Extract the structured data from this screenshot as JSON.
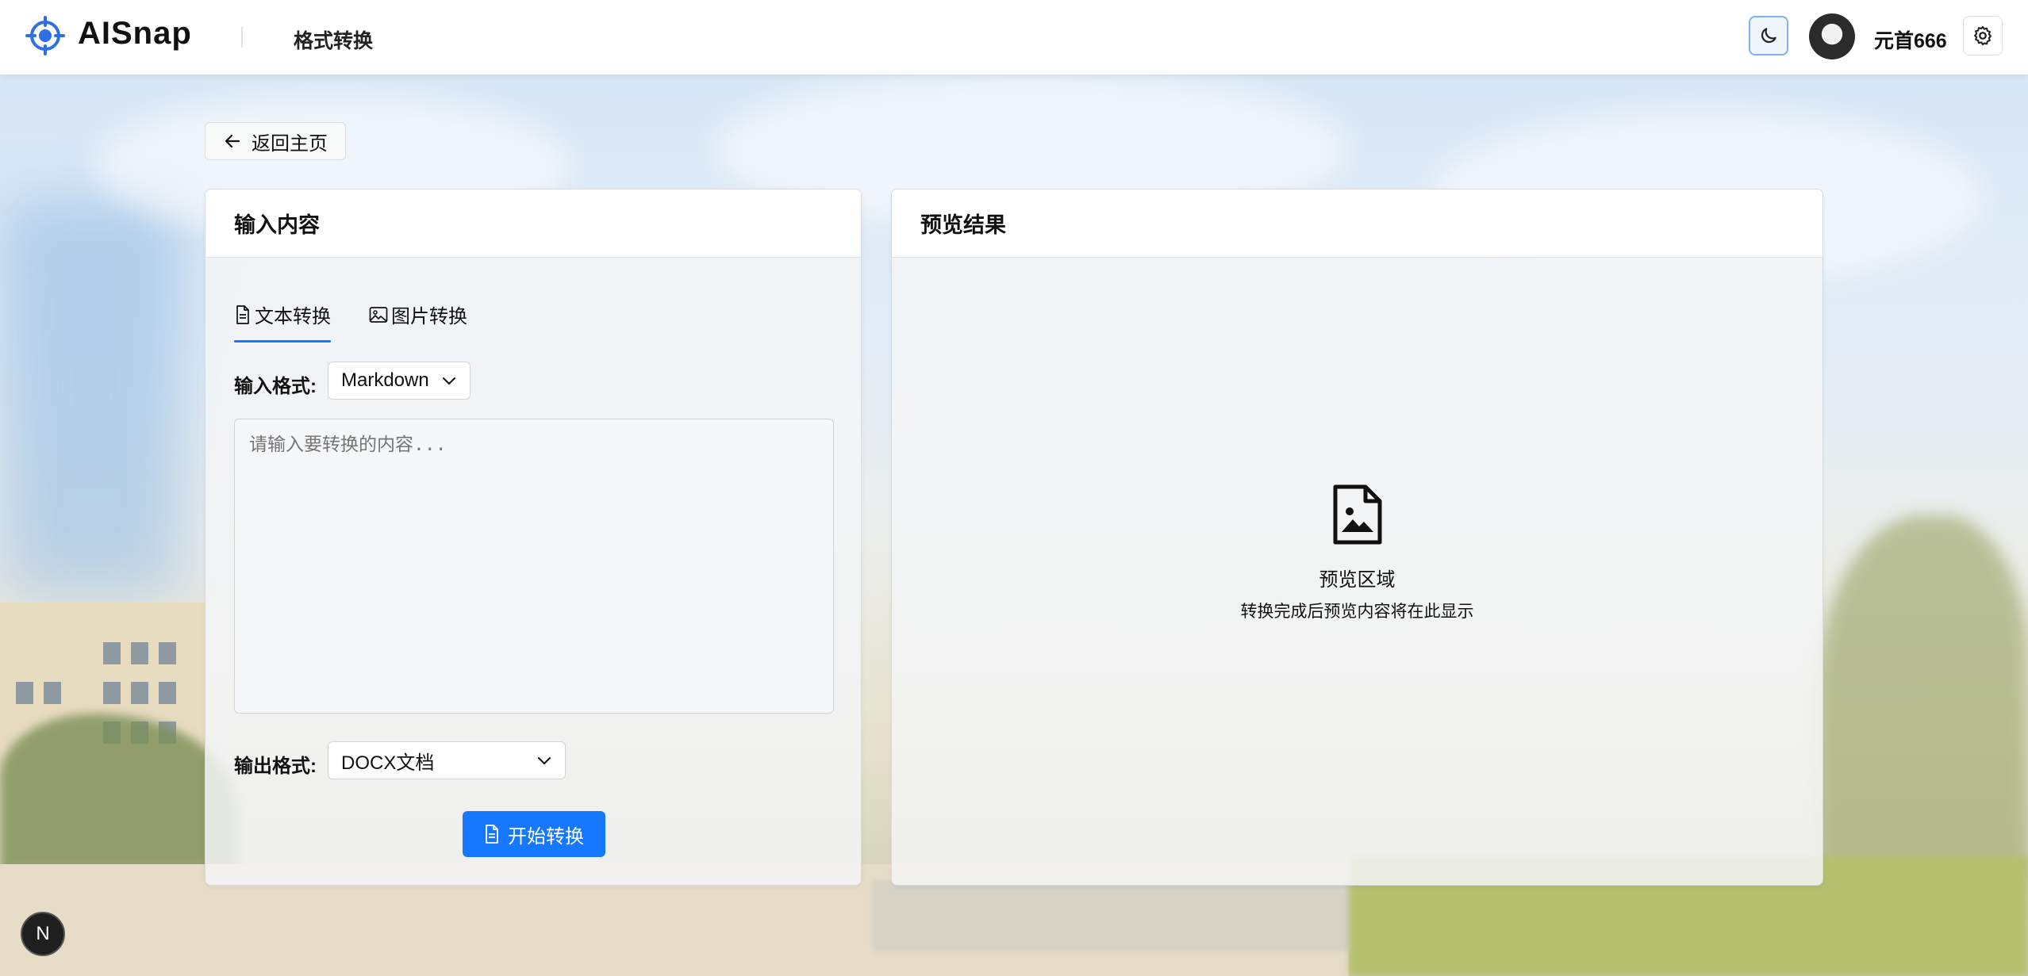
{
  "header": {
    "brand": "AISnap",
    "page_label": "格式转换",
    "username": "元首666"
  },
  "back_button": {
    "label": "返回主页"
  },
  "input_panel": {
    "title": "输入内容",
    "tabs": [
      {
        "label": "文本转换",
        "active": true
      },
      {
        "label": "图片转换",
        "active": false
      }
    ],
    "input_format_label": "输入格式:",
    "input_format_value": "Markdown",
    "textarea_placeholder": "请输入要转换的内容...",
    "output_format_label": "输出格式:",
    "output_format_value": "DOCX文档",
    "convert_button": "开始转换"
  },
  "preview_panel": {
    "title": "预览结果",
    "empty_title": "预览区域",
    "empty_desc": "转换完成后预览内容将在此显示"
  },
  "badge": {
    "letter": "N"
  },
  "colors": {
    "accent": "#1677ff"
  }
}
